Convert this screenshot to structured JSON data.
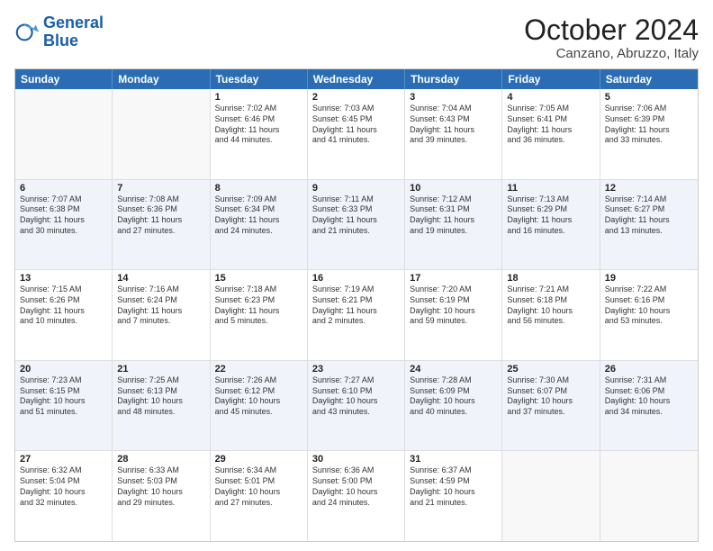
{
  "header": {
    "logo_general": "General",
    "logo_blue": "Blue",
    "month_title": "October 2024",
    "location": "Canzano, Abruzzo, Italy"
  },
  "weekdays": [
    "Sunday",
    "Monday",
    "Tuesday",
    "Wednesday",
    "Thursday",
    "Friday",
    "Saturday"
  ],
  "rows": [
    {
      "alt": false,
      "cells": [
        {
          "day": "",
          "lines": [],
          "empty": true
        },
        {
          "day": "",
          "lines": [],
          "empty": true
        },
        {
          "day": "1",
          "lines": [
            "Sunrise: 7:02 AM",
            "Sunset: 6:46 PM",
            "Daylight: 11 hours",
            "and 44 minutes."
          ]
        },
        {
          "day": "2",
          "lines": [
            "Sunrise: 7:03 AM",
            "Sunset: 6:45 PM",
            "Daylight: 11 hours",
            "and 41 minutes."
          ]
        },
        {
          "day": "3",
          "lines": [
            "Sunrise: 7:04 AM",
            "Sunset: 6:43 PM",
            "Daylight: 11 hours",
            "and 39 minutes."
          ]
        },
        {
          "day": "4",
          "lines": [
            "Sunrise: 7:05 AM",
            "Sunset: 6:41 PM",
            "Daylight: 11 hours",
            "and 36 minutes."
          ]
        },
        {
          "day": "5",
          "lines": [
            "Sunrise: 7:06 AM",
            "Sunset: 6:39 PM",
            "Daylight: 11 hours",
            "and 33 minutes."
          ]
        }
      ]
    },
    {
      "alt": true,
      "cells": [
        {
          "day": "6",
          "lines": [
            "Sunrise: 7:07 AM",
            "Sunset: 6:38 PM",
            "Daylight: 11 hours",
            "and 30 minutes."
          ]
        },
        {
          "day": "7",
          "lines": [
            "Sunrise: 7:08 AM",
            "Sunset: 6:36 PM",
            "Daylight: 11 hours",
            "and 27 minutes."
          ]
        },
        {
          "day": "8",
          "lines": [
            "Sunrise: 7:09 AM",
            "Sunset: 6:34 PM",
            "Daylight: 11 hours",
            "and 24 minutes."
          ]
        },
        {
          "day": "9",
          "lines": [
            "Sunrise: 7:11 AM",
            "Sunset: 6:33 PM",
            "Daylight: 11 hours",
            "and 21 minutes."
          ]
        },
        {
          "day": "10",
          "lines": [
            "Sunrise: 7:12 AM",
            "Sunset: 6:31 PM",
            "Daylight: 11 hours",
            "and 19 minutes."
          ]
        },
        {
          "day": "11",
          "lines": [
            "Sunrise: 7:13 AM",
            "Sunset: 6:29 PM",
            "Daylight: 11 hours",
            "and 16 minutes."
          ]
        },
        {
          "day": "12",
          "lines": [
            "Sunrise: 7:14 AM",
            "Sunset: 6:27 PM",
            "Daylight: 11 hours",
            "and 13 minutes."
          ]
        }
      ]
    },
    {
      "alt": false,
      "cells": [
        {
          "day": "13",
          "lines": [
            "Sunrise: 7:15 AM",
            "Sunset: 6:26 PM",
            "Daylight: 11 hours",
            "and 10 minutes."
          ]
        },
        {
          "day": "14",
          "lines": [
            "Sunrise: 7:16 AM",
            "Sunset: 6:24 PM",
            "Daylight: 11 hours",
            "and 7 minutes."
          ]
        },
        {
          "day": "15",
          "lines": [
            "Sunrise: 7:18 AM",
            "Sunset: 6:23 PM",
            "Daylight: 11 hours",
            "and 5 minutes."
          ]
        },
        {
          "day": "16",
          "lines": [
            "Sunrise: 7:19 AM",
            "Sunset: 6:21 PM",
            "Daylight: 11 hours",
            "and 2 minutes."
          ]
        },
        {
          "day": "17",
          "lines": [
            "Sunrise: 7:20 AM",
            "Sunset: 6:19 PM",
            "Daylight: 10 hours",
            "and 59 minutes."
          ]
        },
        {
          "day": "18",
          "lines": [
            "Sunrise: 7:21 AM",
            "Sunset: 6:18 PM",
            "Daylight: 10 hours",
            "and 56 minutes."
          ]
        },
        {
          "day": "19",
          "lines": [
            "Sunrise: 7:22 AM",
            "Sunset: 6:16 PM",
            "Daylight: 10 hours",
            "and 53 minutes."
          ]
        }
      ]
    },
    {
      "alt": true,
      "cells": [
        {
          "day": "20",
          "lines": [
            "Sunrise: 7:23 AM",
            "Sunset: 6:15 PM",
            "Daylight: 10 hours",
            "and 51 minutes."
          ]
        },
        {
          "day": "21",
          "lines": [
            "Sunrise: 7:25 AM",
            "Sunset: 6:13 PM",
            "Daylight: 10 hours",
            "and 48 minutes."
          ]
        },
        {
          "day": "22",
          "lines": [
            "Sunrise: 7:26 AM",
            "Sunset: 6:12 PM",
            "Daylight: 10 hours",
            "and 45 minutes."
          ]
        },
        {
          "day": "23",
          "lines": [
            "Sunrise: 7:27 AM",
            "Sunset: 6:10 PM",
            "Daylight: 10 hours",
            "and 43 minutes."
          ]
        },
        {
          "day": "24",
          "lines": [
            "Sunrise: 7:28 AM",
            "Sunset: 6:09 PM",
            "Daylight: 10 hours",
            "and 40 minutes."
          ]
        },
        {
          "day": "25",
          "lines": [
            "Sunrise: 7:30 AM",
            "Sunset: 6:07 PM",
            "Daylight: 10 hours",
            "and 37 minutes."
          ]
        },
        {
          "day": "26",
          "lines": [
            "Sunrise: 7:31 AM",
            "Sunset: 6:06 PM",
            "Daylight: 10 hours",
            "and 34 minutes."
          ]
        }
      ]
    },
    {
      "alt": false,
      "cells": [
        {
          "day": "27",
          "lines": [
            "Sunrise: 6:32 AM",
            "Sunset: 5:04 PM",
            "Daylight: 10 hours",
            "and 32 minutes."
          ]
        },
        {
          "day": "28",
          "lines": [
            "Sunrise: 6:33 AM",
            "Sunset: 5:03 PM",
            "Daylight: 10 hours",
            "and 29 minutes."
          ]
        },
        {
          "day": "29",
          "lines": [
            "Sunrise: 6:34 AM",
            "Sunset: 5:01 PM",
            "Daylight: 10 hours",
            "and 27 minutes."
          ]
        },
        {
          "day": "30",
          "lines": [
            "Sunrise: 6:36 AM",
            "Sunset: 5:00 PM",
            "Daylight: 10 hours",
            "and 24 minutes."
          ]
        },
        {
          "day": "31",
          "lines": [
            "Sunrise: 6:37 AM",
            "Sunset: 4:59 PM",
            "Daylight: 10 hours",
            "and 21 minutes."
          ]
        },
        {
          "day": "",
          "lines": [],
          "empty": true
        },
        {
          "day": "",
          "lines": [],
          "empty": true
        }
      ]
    }
  ]
}
